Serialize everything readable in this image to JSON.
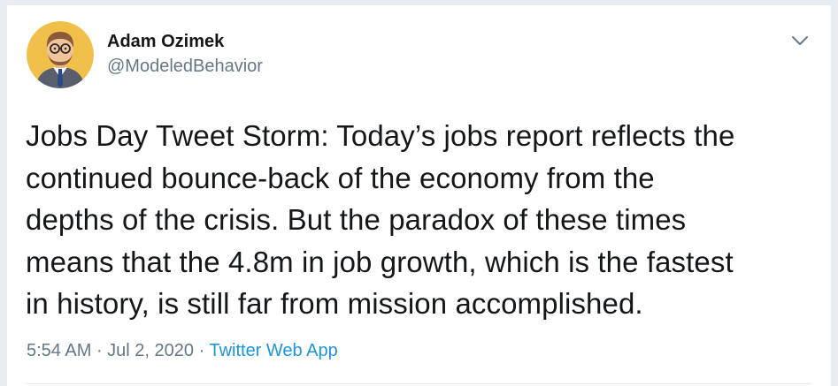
{
  "author": {
    "display_name": "Adam Ozimek",
    "handle": "@ModeledBehavior",
    "avatar_icon": "cartoon-portrait-avatar"
  },
  "tweet": {
    "text": "Jobs Day Tweet Storm: Today’s jobs report reflects the\ncontinued bounce-back of the economy from the\ndepths of the crisis. But the paradox of these times\nmeans that the 4.8m in job growth, which is the fastest\nin history, is still far from mission accomplished."
  },
  "meta": {
    "time": "5:54 AM",
    "separator1": " · ",
    "date": "Jul 2, 2020",
    "separator2": " · ",
    "source": "Twitter Web App"
  },
  "menu": {
    "icon": "chevron-down-icon"
  },
  "colors": {
    "text_primary": "#14171a",
    "text_secondary": "#657786",
    "link": "#1b95e0",
    "avatar_bg": "#f2c94c"
  }
}
